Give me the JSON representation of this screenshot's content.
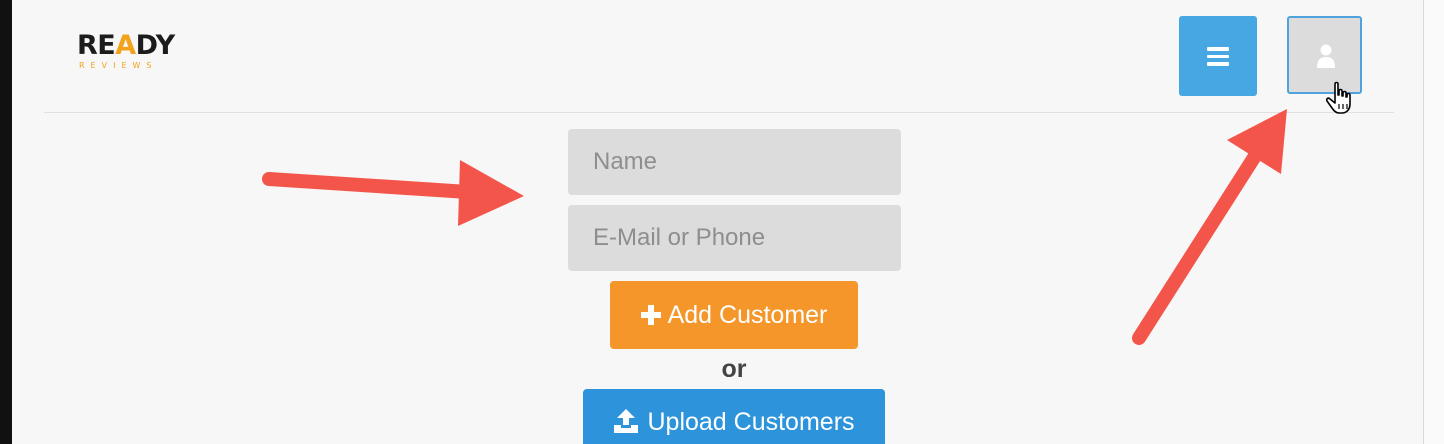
{
  "brand": {
    "logo_word_part1": "RE",
    "logo_word_highlight": "A",
    "logo_word_part2": "DY",
    "logo_subtitle": "REVIEWS",
    "accent_color": "#f2a31c"
  },
  "header": {
    "menu_button_icon": "hamburger-menu-icon",
    "user_button_icon": "user-icon",
    "menu_button_color": "#46a7e2"
  },
  "form": {
    "name_placeholder": "Name",
    "contact_placeholder": "E-Mail or Phone",
    "add_button_label": "Add Customer",
    "add_button_icon": "plus-icon",
    "add_button_color": "#f5962a",
    "or_text": "or",
    "upload_button_label": "Upload Customers",
    "upload_button_icon": "upload-icon",
    "upload_button_color": "#2d94dc"
  },
  "annotations": {
    "arrow_color": "#f4554a",
    "cursor_icon": "hand-pointer-cursor-icon"
  }
}
